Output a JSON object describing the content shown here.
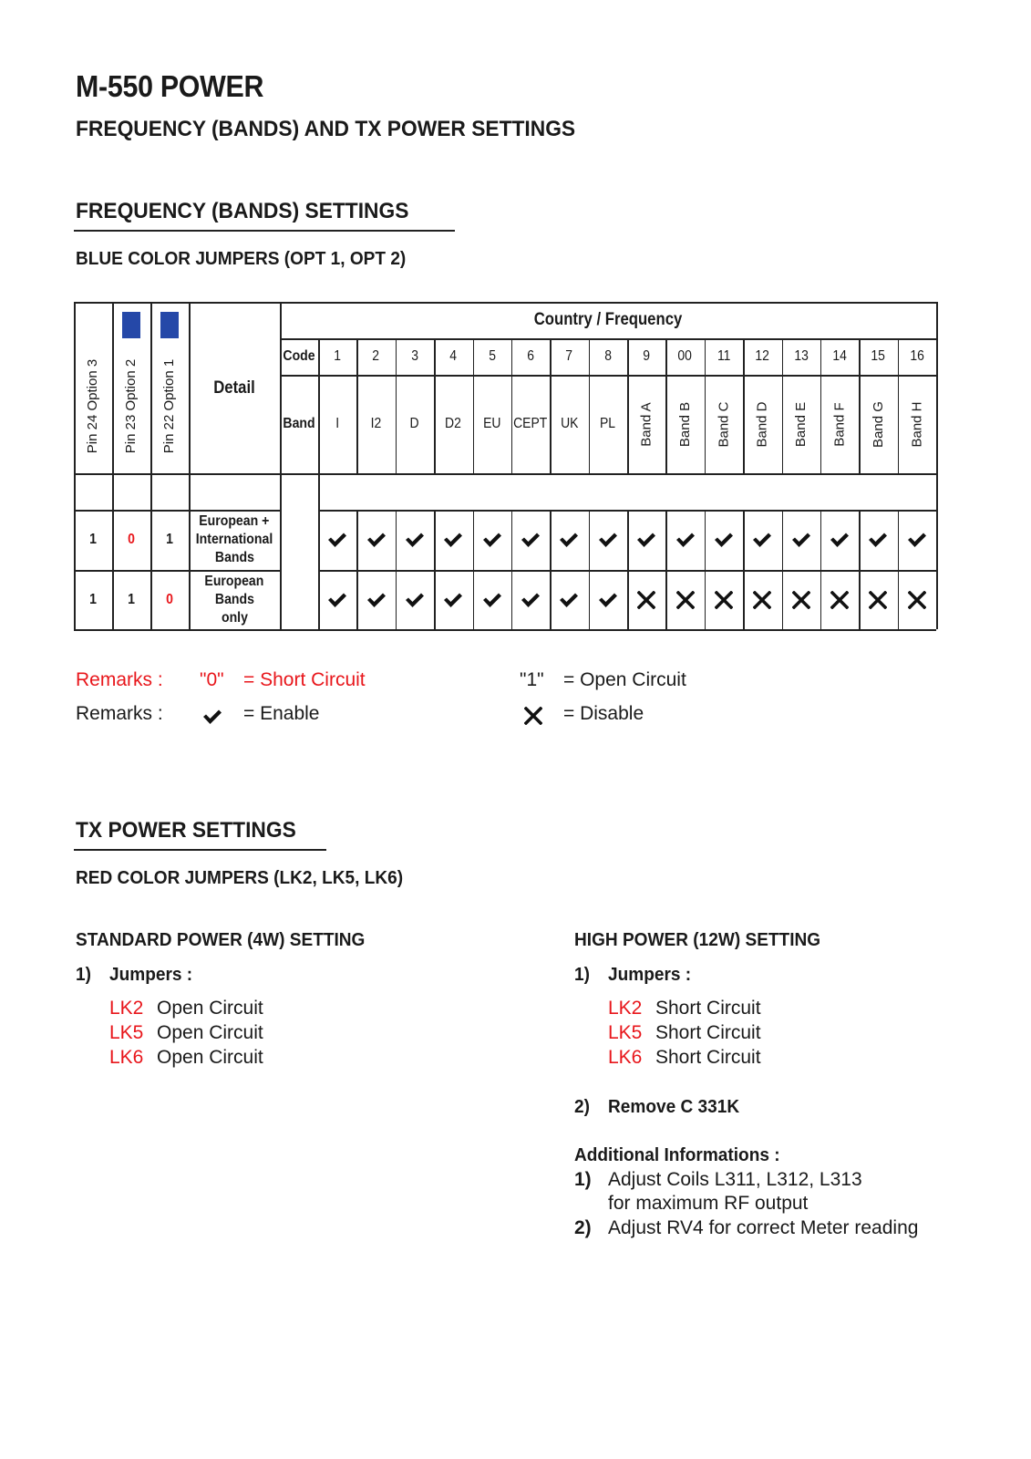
{
  "document": {
    "title": "M-550 POWER",
    "subtitle": "FREQUENCY (BANDS) AND TX POWER SETTINGS"
  },
  "frequency_section": {
    "heading": "FREQUENCY (BANDS) SETTINGS",
    "jumpers_heading": "BLUE COLOR JUMPERS  (OPT 1, OPT 2)",
    "jumper_color": "#2548a8",
    "table": {
      "pin_headers": [
        "Pin 24 Option 3",
        "Pin 23 Option 2",
        "Pin 22 Option 1"
      ],
      "pin_has_blue_jumper": [
        false,
        true,
        true
      ],
      "detail_header": "Detail",
      "group_header": "Country / Frequency",
      "code_label": "Code",
      "band_label": "Band",
      "codes": [
        "1",
        "2",
        "3",
        "4",
        "5",
        "6",
        "7",
        "8",
        "9",
        "00",
        "11",
        "12",
        "13",
        "14",
        "15",
        "16"
      ],
      "bands": [
        "I",
        "I2",
        "D",
        "D2",
        "EU",
        "CEPT",
        "UK",
        "PL",
        "Band A",
        "Band B",
        "Band C",
        "Band D",
        "Band E",
        "Band F",
        "Band G",
        "Band H"
      ],
      "rows": [
        {
          "pins": [
            "1",
            "0",
            "1"
          ],
          "detail_lines": [
            "European +",
            "International",
            "Bands"
          ],
          "status": [
            "enable",
            "enable",
            "enable",
            "enable",
            "enable",
            "enable",
            "enable",
            "enable",
            "enable",
            "enable",
            "enable",
            "enable",
            "enable",
            "enable",
            "enable",
            "enable"
          ]
        },
        {
          "pins": [
            "1",
            "1",
            "0"
          ],
          "detail_lines": [
            "European",
            "Bands",
            "only"
          ],
          "status": [
            "enable",
            "enable",
            "enable",
            "enable",
            "enable",
            "enable",
            "enable",
            "enable",
            "disable",
            "disable",
            "disable",
            "disable",
            "disable",
            "disable",
            "disable",
            "disable"
          ]
        }
      ]
    },
    "remarks": [
      {
        "label": "Remarks :",
        "items": [
          {
            "key": "\"0\"",
            "text": "= Short Circuit"
          },
          {
            "key": "\"1\"",
            "text": "= Open Circuit"
          }
        ]
      },
      {
        "label": "Remarks :",
        "items": [
          {
            "key_icon": "check-icon",
            "text": "= Enable"
          },
          {
            "key_icon": "cross-icon",
            "text": "= Disable"
          }
        ]
      }
    ]
  },
  "tx_section": {
    "heading": "TX POWER SETTINGS",
    "jumpers_heading": "RED COLOR JUMPERS  (LK2, LK5, LK6)",
    "standard": {
      "heading": "STANDARD POWER (4W) SETTING",
      "step1_num": "1)",
      "step1_label": "Jumpers :",
      "jumpers": [
        {
          "name": "LK2",
          "state": "Open Circuit"
        },
        {
          "name": "LK5",
          "state": "Open Circuit"
        },
        {
          "name": "LK6",
          "state": "Open Circuit"
        }
      ]
    },
    "high": {
      "heading": "HIGH POWER (12W) SETTING",
      "step1_num": "1)",
      "step1_label": "Jumpers :",
      "jumpers": [
        {
          "name": "LK2",
          "state": "Short Circuit"
        },
        {
          "name": "LK5",
          "state": "Short Circuit"
        },
        {
          "name": "LK6",
          "state": "Short Circuit"
        }
      ],
      "step2_num": "2)",
      "step2_label": "Remove C 331K",
      "additional_heading": "Additional Informations :",
      "additional": [
        {
          "num": "1)",
          "lines": [
            "Adjust Coils L311, L312, L313",
            "for maximum RF output"
          ]
        },
        {
          "num": "2)",
          "lines": [
            "Adjust RV4 for correct Meter reading"
          ]
        }
      ]
    }
  },
  "colors": {
    "accent_red": "#e8161b",
    "text": "#1a1a1a"
  }
}
